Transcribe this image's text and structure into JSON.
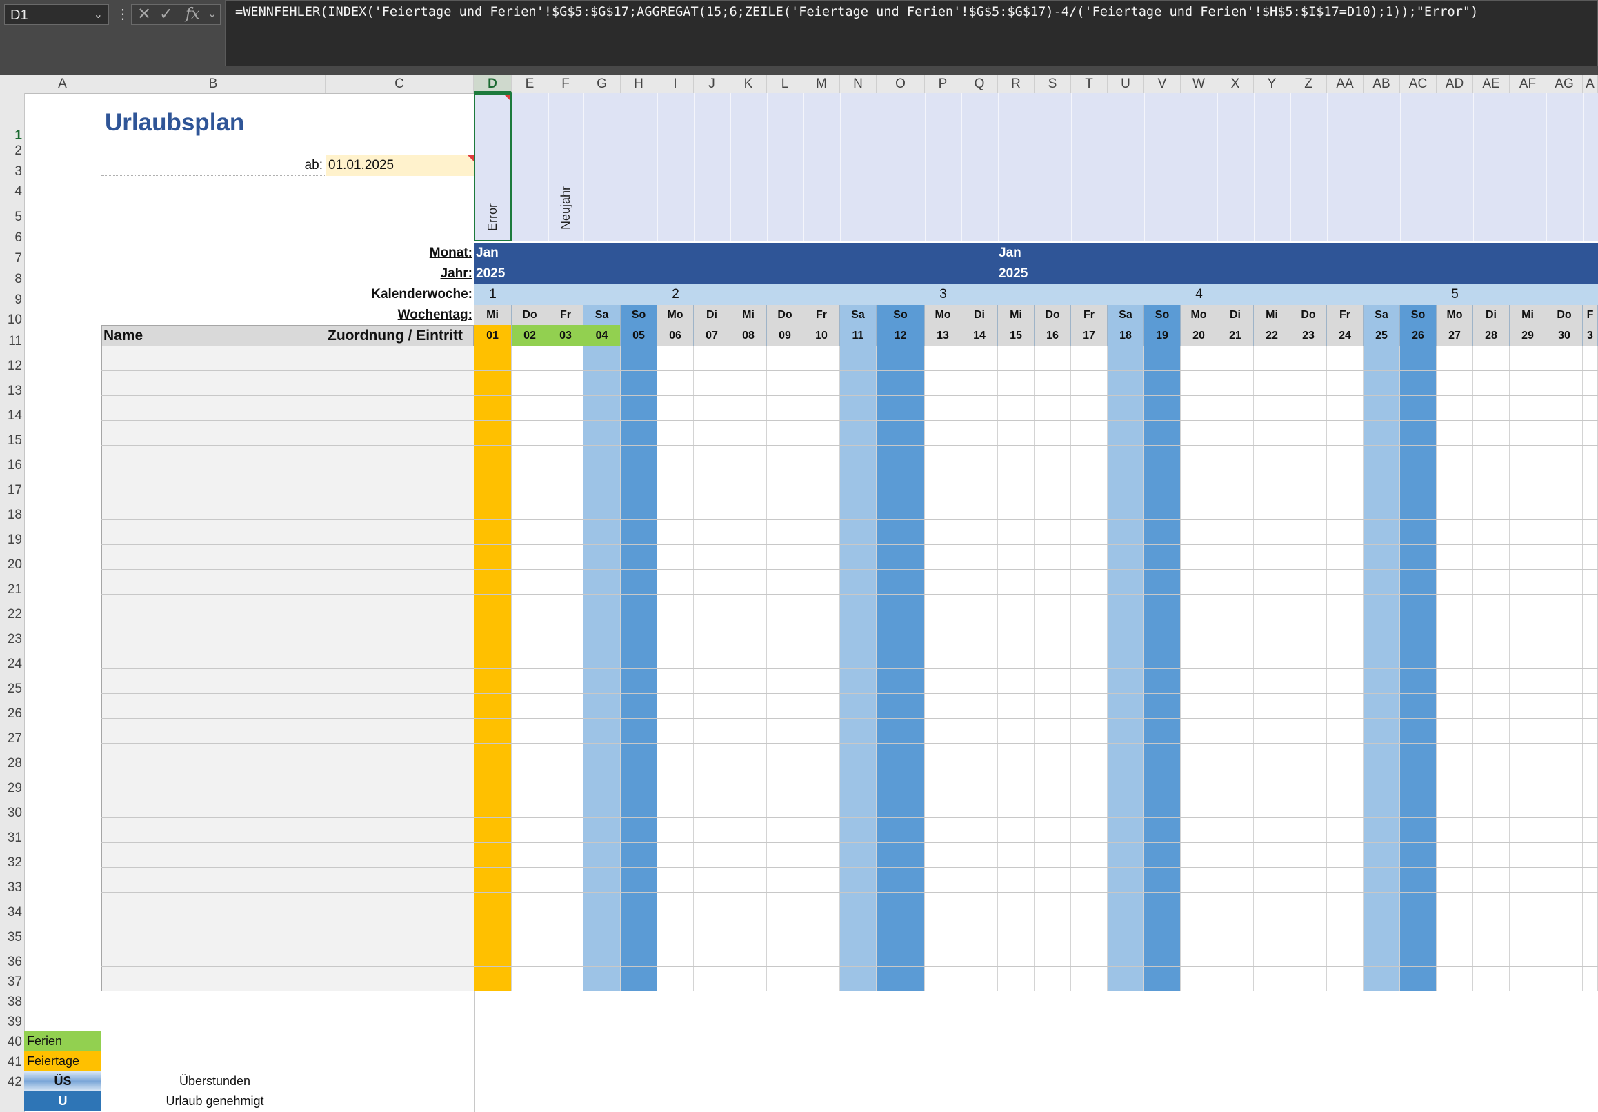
{
  "namebox": "D1",
  "formula": "=WENNFEHLER(INDEX('Feiertage und Ferien'!$G$5:$G$17;AGGREGAT(15;6;ZEILE('Feiertage und Ferien'!$G$5:$G$17)-4/('Feiertage und Ferien'!$H$5:$I$17=D10);1));\"Error\")",
  "columns": [
    "A",
    "B",
    "C",
    "D",
    "E",
    "F",
    "G",
    "H",
    "I",
    "J",
    "K",
    "L",
    "M",
    "N",
    "O",
    "P",
    "Q",
    "R",
    "S",
    "T",
    "U",
    "V",
    "W",
    "X",
    "Y",
    "Z",
    "AA",
    "AB",
    "AC",
    "AD",
    "AE",
    "AF",
    "AG",
    "A"
  ],
  "rows": [
    "1",
    "2",
    "3",
    "4",
    "5",
    "6",
    "7",
    "8",
    "9",
    "10",
    "11",
    "12",
    "13",
    "14",
    "15",
    "16",
    "17",
    "18",
    "19",
    "20",
    "21",
    "22",
    "23",
    "24",
    "25",
    "26",
    "27",
    "28",
    "29",
    "30",
    "31",
    "32",
    "33",
    "34",
    "35",
    "36",
    "37",
    "38",
    "39",
    "40",
    "41",
    "42"
  ],
  "sheet": {
    "title": "Urlaubsplan",
    "ab_label": "ab:",
    "ab_value": "01.01.2025",
    "labels": {
      "monat": "Monat:",
      "jahr": "Jahr:",
      "kalenderwoche": "Kalenderwoche:",
      "wochentag": "Wochentag:",
      "name": "Name",
      "zuordnung": "Zuordnung / Eintritt"
    },
    "holiday_texts": [
      "Error",
      "Neujahr"
    ],
    "months": [
      "Jan",
      "Jan"
    ],
    "years": [
      "2025",
      "2025"
    ],
    "weeks": [
      "1",
      "2",
      "3",
      "4",
      "5"
    ],
    "weekdays": [
      "Mi",
      "Do",
      "Fr",
      "Sa",
      "So",
      "Mo",
      "Di",
      "Mi",
      "Do",
      "Fr",
      "Sa",
      "So",
      "Mo",
      "Di",
      "Mi",
      "Do",
      "Fr",
      "Sa",
      "So",
      "Mo",
      "Di",
      "Mi",
      "Do",
      "Fr",
      "Sa",
      "So",
      "Mo",
      "Di",
      "Mi",
      "Do",
      "F"
    ],
    "days": [
      "01",
      "02",
      "03",
      "04",
      "05",
      "06",
      "07",
      "08",
      "09",
      "10",
      "11",
      "12",
      "13",
      "14",
      "15",
      "16",
      "17",
      "18",
      "19",
      "20",
      "21",
      "22",
      "23",
      "24",
      "25",
      "26",
      "27",
      "28",
      "29",
      "30",
      "3"
    ]
  },
  "legend": {
    "ferien": "Ferien",
    "feiertage": "Feiertage",
    "ueberstunden_code": "ÜS",
    "ueberstunden": "Überstunden",
    "urlaub_code": "U",
    "urlaub": "Urlaub genehmigt"
  },
  "colors": {
    "feiertag": "#FFC000",
    "ferien": "#92D050",
    "samstag": "#9DC3E6",
    "sonntag": "#5B9BD5",
    "header_dark": "#2F5597",
    "header_light": "#DEE3F4",
    "kw": "#BDD7EE",
    "title": "#2F5597"
  }
}
